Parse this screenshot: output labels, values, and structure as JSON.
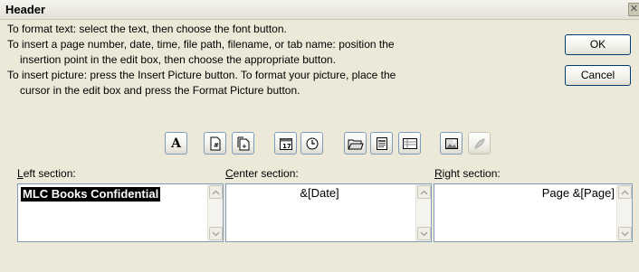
{
  "dialog": {
    "title": "Header",
    "close_glyph": "✕"
  },
  "instructions": {
    "line1": "To format text:  select the text, then choose the font button.",
    "line2": "To insert a page number, date, time, file path, filename, or tab name:  position the",
    "line3": "insertion point in the edit box, then choose the appropriate button.",
    "line4": "To insert picture: press the Insert Picture button.  To format your picture, place the",
    "line5": "cursor in the edit box and press the Format Picture button."
  },
  "buttons": {
    "ok": "OK",
    "cancel": "Cancel"
  },
  "toolbar": {
    "items": [
      {
        "icon": "format-text-icon"
      },
      {
        "icon": "insert-page-number-icon"
      },
      {
        "icon": "insert-number-of-pages-icon"
      },
      {
        "icon": "insert-date-icon"
      },
      {
        "icon": "insert-time-icon"
      },
      {
        "icon": "insert-file-path-icon"
      },
      {
        "icon": "insert-file-name-icon"
      },
      {
        "icon": "insert-sheet-name-icon"
      },
      {
        "icon": "insert-picture-icon"
      },
      {
        "icon": "format-picture-icon",
        "disabled": true
      }
    ],
    "format_text_glyph": "A"
  },
  "sections": {
    "left": {
      "label_u": "L",
      "label_rest": "eft section:",
      "value": "MLC Books Confidential"
    },
    "center": {
      "label_u": "C",
      "label_rest": "enter section:",
      "value": "&[Date]"
    },
    "right": {
      "label_u": "R",
      "label_rest": "ight section:",
      "value": "Page &[Page]"
    }
  },
  "colors": {
    "dialog_bg": "#ece9d8",
    "border_blue": "#7f9db9",
    "selection": "#000000"
  }
}
